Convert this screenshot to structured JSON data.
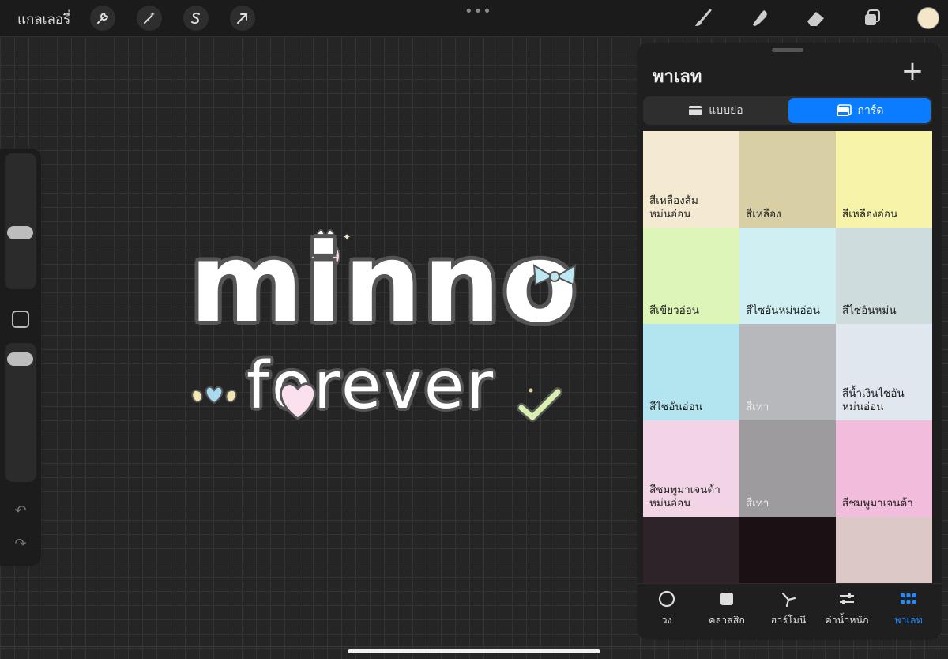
{
  "topbar": {
    "gallery_label": "แกลเลอรี่",
    "tools_left": [
      "wrench-icon",
      "magic-wand-icon",
      "selection-s-icon",
      "transform-arrow-icon"
    ],
    "tools_right": [
      "brush-icon",
      "smudge-icon",
      "eraser-icon",
      "layers-icon"
    ],
    "current_color": "#f6e6c9",
    "more_dots": "•••"
  },
  "canvas": {
    "art_line1": "minno",
    "art_line2": "forever"
  },
  "sidebar": {
    "undo_label": "↶",
    "redo_label": "↷"
  },
  "palette": {
    "title": "พาเลท",
    "add_label": "+",
    "view_compact": "แบบย่อ",
    "view_card": "การ์ด",
    "active_view": "การ์ด",
    "swatches": [
      {
        "label": "สีเหลืองส้ม\nหม่นอ่อน",
        "color": "#f4ead1"
      },
      {
        "label": "สีเหลือง",
        "color": "#d8cfa5"
      },
      {
        "label": "สีเหลืองอ่อน",
        "color": "#f7f3a9"
      },
      {
        "label": "สีเขียวอ่อน",
        "color": "#ddf5b8"
      },
      {
        "label": "สีไซอันหม่นอ่อน",
        "color": "#cfeff3"
      },
      {
        "label": "สีไซอันหม่น",
        "color": "#cfdcdd"
      },
      {
        "label": "สีไซอันอ่อน",
        "color": "#b3e5f1"
      },
      {
        "label": "สีเทา",
        "color": "#b6b8bb",
        "dark": true
      },
      {
        "label": "สีน้ำเงินไซอัน\nหม่นอ่อน",
        "color": "#e0e7ef"
      },
      {
        "label": "สีชมพูมาเจนต้า\nหม่นอ่อน",
        "color": "#f2d4e7"
      },
      {
        "label": "สีเทา",
        "color": "#9e9b9e",
        "dark": true
      },
      {
        "label": "สีชมพูมาเจนต้า",
        "color": "#f2bcdc"
      },
      {
        "label": "",
        "color": "#2f232a"
      },
      {
        "label": "",
        "color": "#1b1013"
      },
      {
        "label": "",
        "color": "#dcc8c6"
      }
    ]
  },
  "bottom_nav": [
    {
      "label": "วง",
      "icon": "disc-icon",
      "active": false
    },
    {
      "label": "คลาสสิก",
      "icon": "classic-square-icon",
      "active": false
    },
    {
      "label": "ฮาร์โมนี",
      "icon": "harmony-icon",
      "active": false
    },
    {
      "label": "ค่าน้ำหนัก",
      "icon": "sliders-icon",
      "active": false
    },
    {
      "label": "พาเลท",
      "icon": "grid-icon",
      "active": true
    }
  ]
}
